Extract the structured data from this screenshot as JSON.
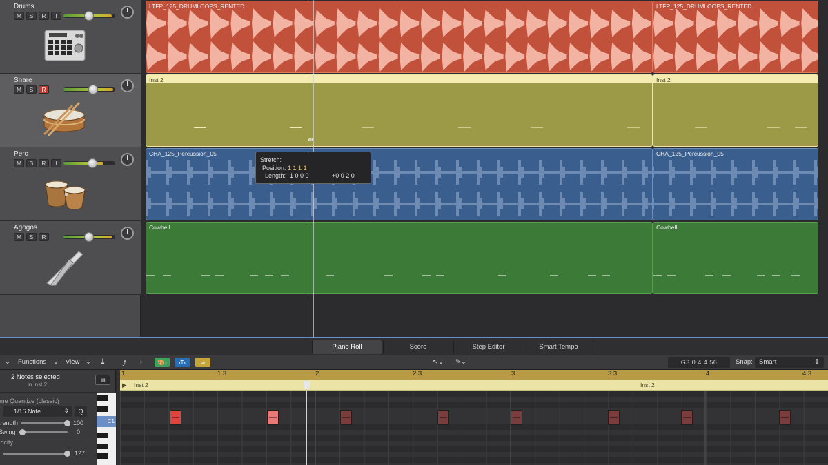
{
  "tracks": [
    {
      "name": "Drums",
      "buttons": [
        "M",
        "S",
        "R",
        "I"
      ],
      "rec_armed": false,
      "icon": "drum-machine-icon"
    },
    {
      "name": "Snare",
      "buttons": [
        "M",
        "S",
        "R"
      ],
      "rec_armed": true,
      "icon": "snare-drum-icon"
    },
    {
      "name": "Perc",
      "buttons": [
        "M",
        "S",
        "R",
        "I"
      ],
      "rec_armed": false,
      "icon": "bongos-icon"
    },
    {
      "name": "Agogos",
      "buttons": [
        "M",
        "S",
        "R"
      ],
      "rec_armed": false,
      "icon": "agogo-bells-icon"
    }
  ],
  "regions": {
    "drums_1": "LTFP_125_DRUMLOOPS_RENTED",
    "drums_2": "LTFP_125_DRUMLOOPS_RENTED",
    "snare_1": "Inst 2",
    "snare_2": "Inst 2",
    "perc_1": "CHA_125_Percussion_05",
    "perc_2": "CHA_125_Percussion_05",
    "agogo_1": "Cowbell",
    "agogo_2": "Cowbell"
  },
  "colors": {
    "drums": "#c2513b",
    "snare": "#9c9a47",
    "perc": "#3a5f8e",
    "agogo": "#3c7a37",
    "rec": "#c03a32",
    "note_selected": "#e0453d"
  },
  "tooltip": {
    "title": "Stretch:",
    "position_label": "Position:",
    "position_value": "1 1 1 1",
    "length_label": "Length:",
    "length_value": "1 0 0 0",
    "length_delta": "+0 0 2 0"
  },
  "editor_tabs": [
    "Piano Roll",
    "Score",
    "Step Editor",
    "Smart Tempo"
  ],
  "active_tab": "Piano Roll",
  "toolbar": {
    "functions": "Functions",
    "view": "View",
    "position_display": "G3   0 4 4 56",
    "snap_label": "Snap:",
    "snap_value": "Smart"
  },
  "inspector": {
    "selection": "2 Notes selected",
    "sub": "in Inst 2",
    "quantize_label": "Time Quantize (classic)",
    "quantize_value": "1/16 Note",
    "q_button": "Q",
    "strength_label": "Strength",
    "strength_value": "100",
    "swing_label": "Swing",
    "swing_value": "0",
    "velocity_label": "Velocity",
    "velocity_value": "127",
    "key_label": "C1"
  },
  "ruler": {
    "bars": [
      "1",
      "1 3",
      "2",
      "2 3",
      "3",
      "3 3",
      "4",
      "4 3"
    ]
  },
  "roll_region": {
    "name_1": "Inst 2",
    "name_2": "Inst 2"
  }
}
